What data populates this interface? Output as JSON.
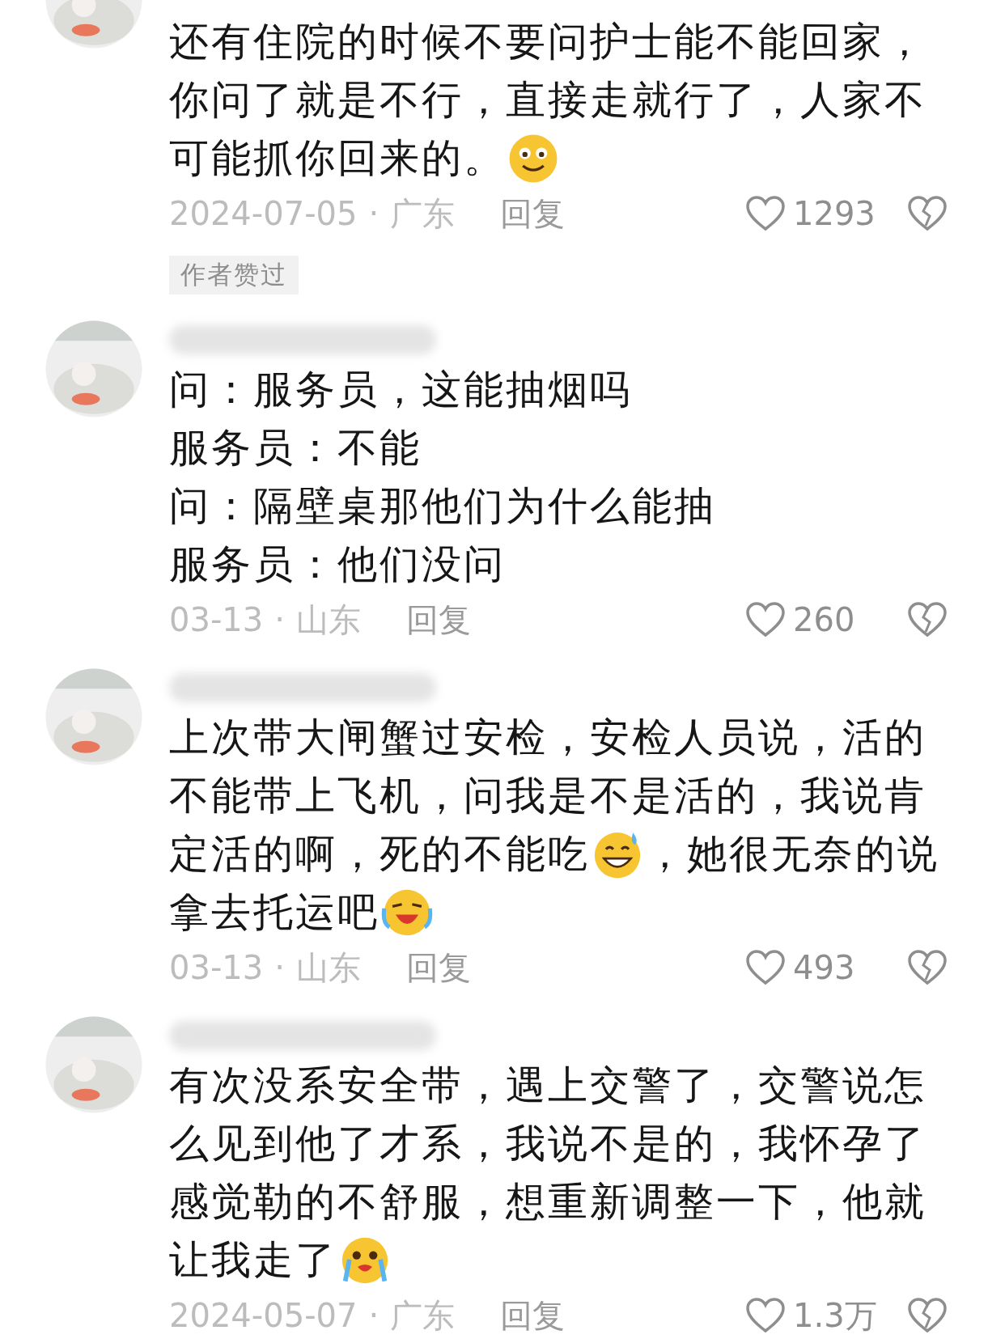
{
  "comments": [
    {
      "author": {
        "visible": false
      },
      "lines": [
        [
          {
            "kind": "text",
            "text": "还有住院的时候不要问护士能不能回家，"
          }
        ],
        [
          {
            "kind": "text",
            "text": "你问了就是不行，直接走就行了，人家不"
          }
        ],
        [
          {
            "kind": "text",
            "text": "可能抓你回来的。"
          },
          {
            "kind": "smile"
          }
        ]
      ],
      "date": "2024-07-05",
      "separator": "·",
      "region": "广东",
      "reply": "回复",
      "likes": "1293",
      "badge": "作者赞过"
    },
    {
      "author": {
        "visible": true
      },
      "lines": [
        [
          {
            "kind": "text",
            "text": "问：服务员，这能抽烟吗"
          }
        ],
        [
          {
            "kind": "text",
            "text": "服务员：不能"
          }
        ],
        [
          {
            "kind": "text",
            "text": "问：隔壁桌那他们为什么能抽"
          }
        ],
        [
          {
            "kind": "text",
            "text": "服务员：他们没问"
          }
        ]
      ],
      "date": "03-13",
      "separator": "·",
      "region": "山东",
      "reply": "回复",
      "likes": "260"
    },
    {
      "author": {
        "visible": true
      },
      "lines": [
        [
          {
            "kind": "text",
            "text": "上次带大闸蟹过安检，安检人员说，活的"
          }
        ],
        [
          {
            "kind": "text",
            "text": "不能带上飞机，问我是不是活的，我说肯"
          }
        ],
        [
          {
            "kind": "text",
            "text": "定活的啊，死的不能吃"
          },
          {
            "kind": "sweat"
          },
          {
            "kind": "text",
            "text": "，她很无奈的说"
          }
        ],
        [
          {
            "kind": "text",
            "text": "拿去托运吧"
          },
          {
            "kind": "laugh"
          }
        ]
      ],
      "date": "03-13",
      "separator": "·",
      "region": "山东",
      "reply": "回复",
      "likes": "493"
    },
    {
      "author": {
        "visible": true
      },
      "lines": [
        [
          {
            "kind": "text",
            "text": "有次没系安全带，遇上交警了，交警说怎"
          }
        ],
        [
          {
            "kind": "text",
            "text": "么见到他了才系，我说不是的，我怀孕了"
          }
        ],
        [
          {
            "kind": "text",
            "text": "感觉勒的不舒服，想重新调整一下，他就"
          }
        ],
        [
          {
            "kind": "text",
            "text": "让我走了"
          },
          {
            "kind": "cry"
          }
        ]
      ],
      "date": "2024-05-07",
      "separator": "·",
      "region": "广东",
      "reply": "回复",
      "likes": "1.3万"
    }
  ]
}
